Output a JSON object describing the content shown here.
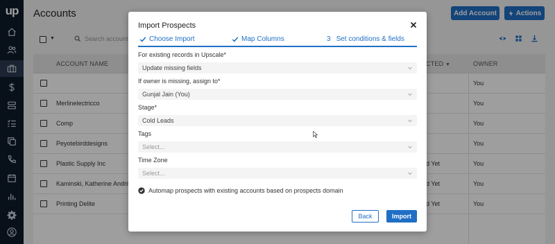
{
  "app": {
    "logo": "up"
  },
  "page": {
    "title": "Accounts",
    "add_account_label": "Add Account",
    "actions_label": "Actions",
    "search_placeholder": "Search account..."
  },
  "table": {
    "headers": {
      "account_name": "ACCOUNT NAME",
      "contacted": "CTED",
      "owner": "OWNER"
    },
    "rows": [
      {
        "name": "",
        "status": "",
        "owner": "You"
      },
      {
        "name": "Merlinelectricco",
        "status": "",
        "owner": "You"
      },
      {
        "name": "Comp",
        "status": "",
        "owner": "You"
      },
      {
        "name": "Peyotebirddesigns",
        "status": "",
        "owner": "You"
      },
      {
        "name": "Plastic Supply Inc",
        "status": "d Yet",
        "owner": "You"
      },
      {
        "name": "Kaminski, Katherine Andritsak",
        "status": "d Yet",
        "owner": "You"
      },
      {
        "name": "Printing Delite",
        "status": "d Yet",
        "owner": "You"
      }
    ]
  },
  "modal": {
    "title": "Import Prospects",
    "steps": [
      {
        "label": "Choose Import",
        "marker": "check"
      },
      {
        "label": "Map Columns",
        "marker": "check"
      },
      {
        "number": "3",
        "label": "Set conditions & fields"
      }
    ],
    "fields": [
      {
        "label": "For existing records in Upscale*",
        "value": "Update missing fields",
        "placeholder": false
      },
      {
        "label": "If owner is missing, assign to*",
        "value": "Gunjal Jain (You)",
        "placeholder": false
      },
      {
        "label": "Stage*",
        "value": "Cold Leads",
        "placeholder": false
      },
      {
        "label": "Tags",
        "value": "Select...",
        "placeholder": true
      },
      {
        "label": "Time Zone",
        "value": "Select...",
        "placeholder": true
      }
    ],
    "automap_label": "Automap prospects with existing accounts based on prospects domain",
    "back_label": "Back",
    "import_label": "Import"
  },
  "colors": {
    "accent": "#1f6fc5",
    "nav_bg": "#0e1a2b"
  }
}
